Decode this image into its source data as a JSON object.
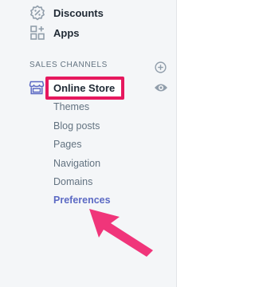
{
  "nav": {
    "discounts_label": "Discounts",
    "apps_label": "Apps"
  },
  "sales_channels": {
    "header": "SALES CHANNELS",
    "online_store": {
      "label": "Online Store",
      "sub_items": [
        {
          "label": "Themes",
          "active": false
        },
        {
          "label": "Blog posts",
          "active": false
        },
        {
          "label": "Pages",
          "active": false
        },
        {
          "label": "Navigation",
          "active": false
        },
        {
          "label": "Domains",
          "active": false
        },
        {
          "label": "Preferences",
          "active": true
        }
      ]
    }
  },
  "colors": {
    "highlight_border": "#e6185e",
    "active_link": "#5c6ac4",
    "annotation_arrow": "#f0357a"
  },
  "icons": {
    "discounts": "percent-badge-icon",
    "apps": "apps-grid-icon",
    "add_channel": "plus-circle-icon",
    "online_store": "storefront-icon",
    "view_store": "eye-icon"
  }
}
